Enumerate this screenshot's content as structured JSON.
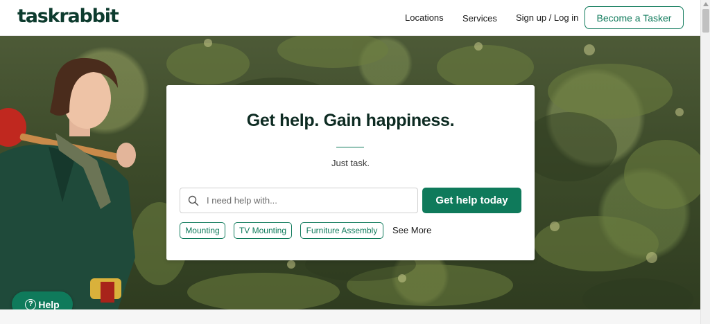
{
  "header": {
    "logo": "taskrabbit",
    "nav": {
      "locations": "Locations",
      "services": "Services",
      "auth": "Sign up / Log in"
    },
    "cta": "Become a Tasker"
  },
  "hero": {
    "title": "Get help. Gain happiness.",
    "subtitle": "Just task.",
    "search": {
      "placeholder": "I need help with...",
      "value": ""
    },
    "submit": "Get help today",
    "chips": [
      "Mounting",
      "TV Mounting",
      "Furniture Assembly"
    ],
    "see_more": "See More"
  },
  "help_fab": {
    "icon": "?",
    "label": "Help"
  },
  "colors": {
    "brand_green": "#0f7a5b",
    "logo_dark": "#0d3b2e"
  },
  "icons": [
    "search-icon",
    "help-icon",
    "scroll-up-arrow-icon"
  ]
}
